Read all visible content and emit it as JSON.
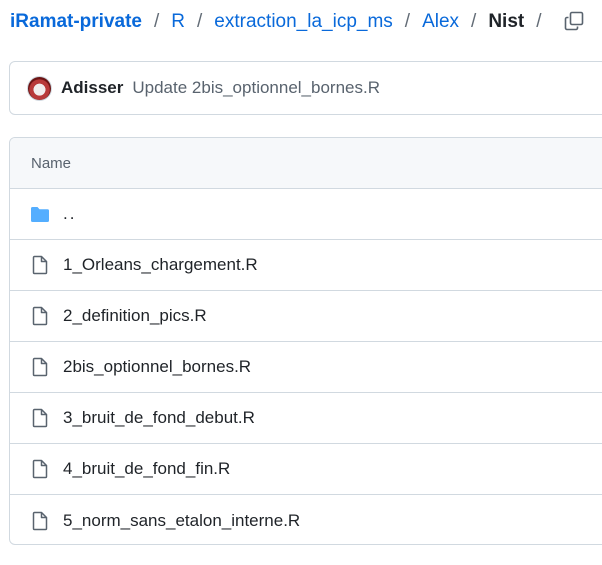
{
  "breadcrumb": {
    "repo": "iRamat-private",
    "segments": [
      "R",
      "extraction_la_icp_ms",
      "Alex"
    ],
    "current": "Nist",
    "separator": "/"
  },
  "header_icons": {
    "copy": "copy-icon"
  },
  "commit": {
    "author": "Adisser",
    "message": "Update 2bis_optionnel_bornes.R"
  },
  "table": {
    "header": "Name",
    "parent_label": "..",
    "files": [
      "1_Orleans_chargement.R",
      "2_definition_pics.R",
      "2bis_optionnel_bornes.R",
      "3_bruit_de_fond_debut.R",
      "4_bruit_de_fond_fin.R",
      "5_norm_sans_etalon_interne.R"
    ]
  },
  "colors": {
    "link": "#0969da",
    "folder": "#54aeff",
    "file_icon": "#59636e",
    "border": "#d1d9e0"
  }
}
